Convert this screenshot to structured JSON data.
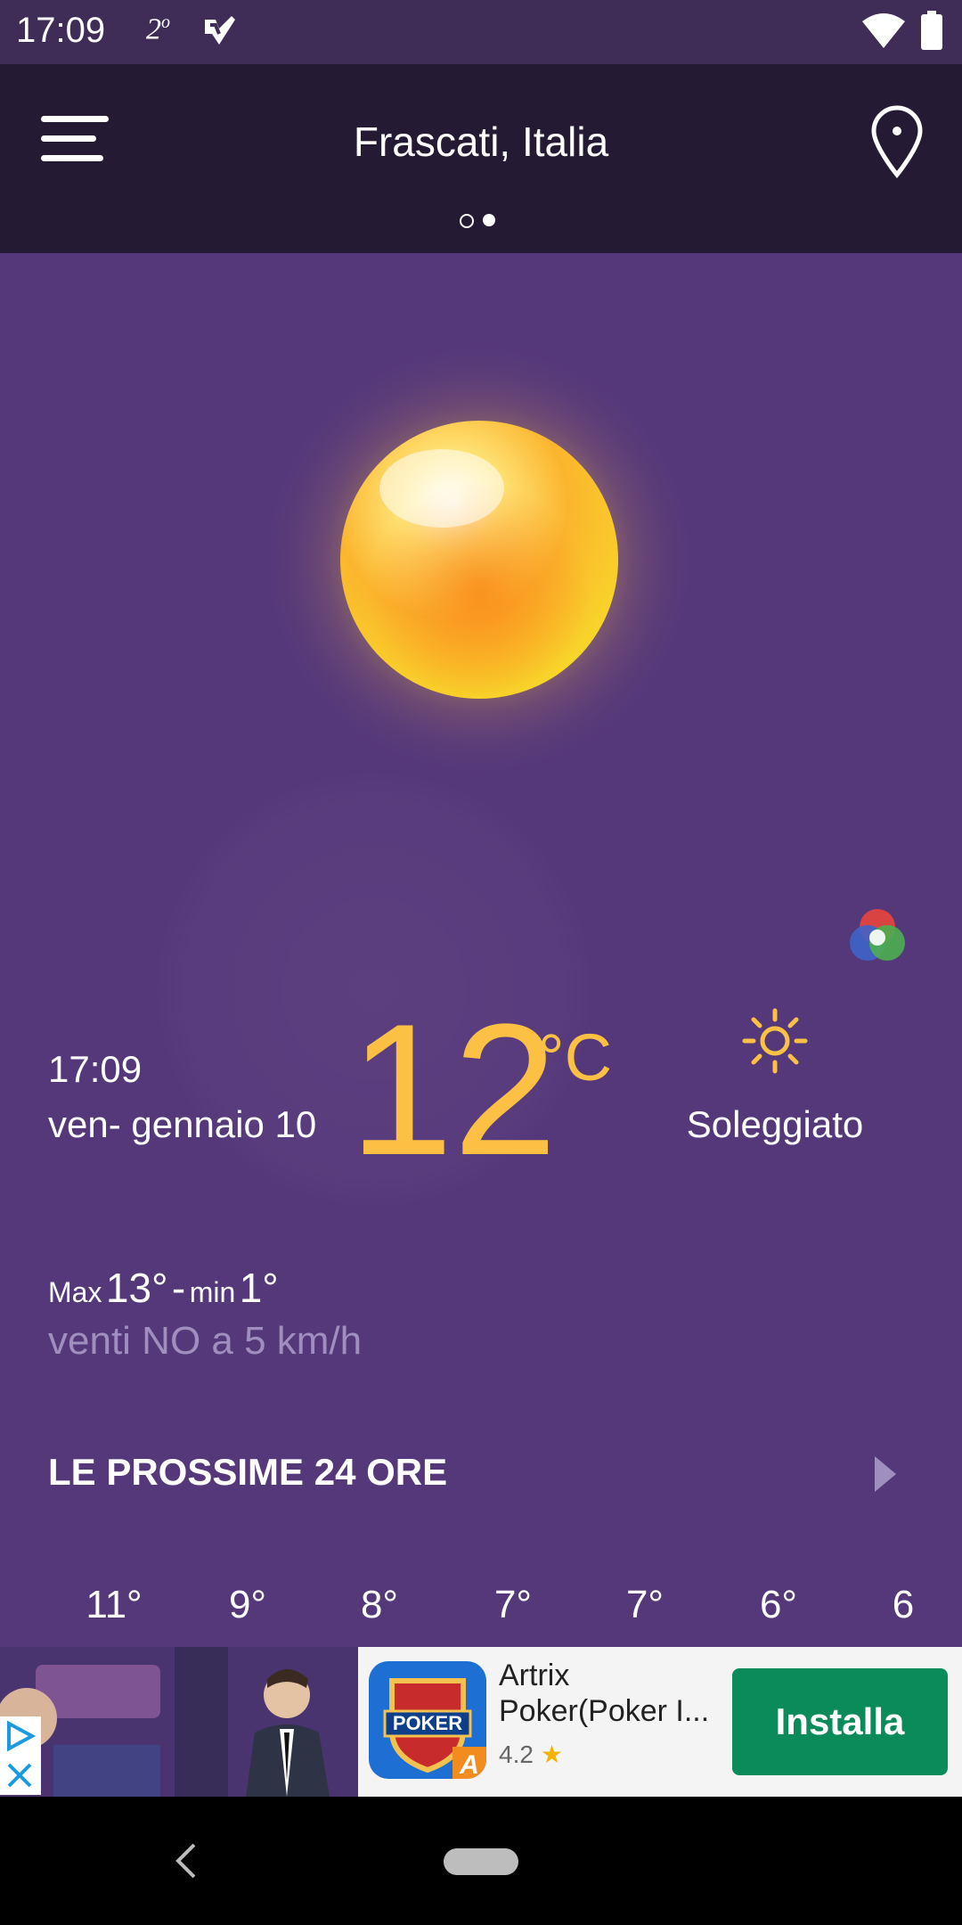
{
  "status_bar": {
    "time": "17:09",
    "temp_badge": "2",
    "temp_badge_sup": "o"
  },
  "app_bar": {
    "location_title": "Frascati, Italia"
  },
  "current": {
    "time": "17:09",
    "date": "ven- gennaio 10",
    "temperature": "12",
    "unit": "°C",
    "condition": "Soleggiato",
    "max_label": "Max",
    "max_value": "13°",
    "separator": "-",
    "min_label": "min",
    "min_value": "1°",
    "wind": "venti NO a 5 km/h"
  },
  "next_24h": {
    "title": "LE PROSSIME 24 ORE",
    "temps": [
      "11°",
      "9°",
      "8°",
      "7°",
      "7°",
      "6°",
      "6"
    ]
  },
  "ad": {
    "app_name": "Artrix Poker(Poker I...",
    "rating": "4.2",
    "install_label": "Installa",
    "icon_text": "POKER"
  },
  "colors": {
    "background": "#55387a",
    "app_bar": "#251a33",
    "temperature_accent": "#fcc044",
    "install_button": "#0b8a5a"
  }
}
